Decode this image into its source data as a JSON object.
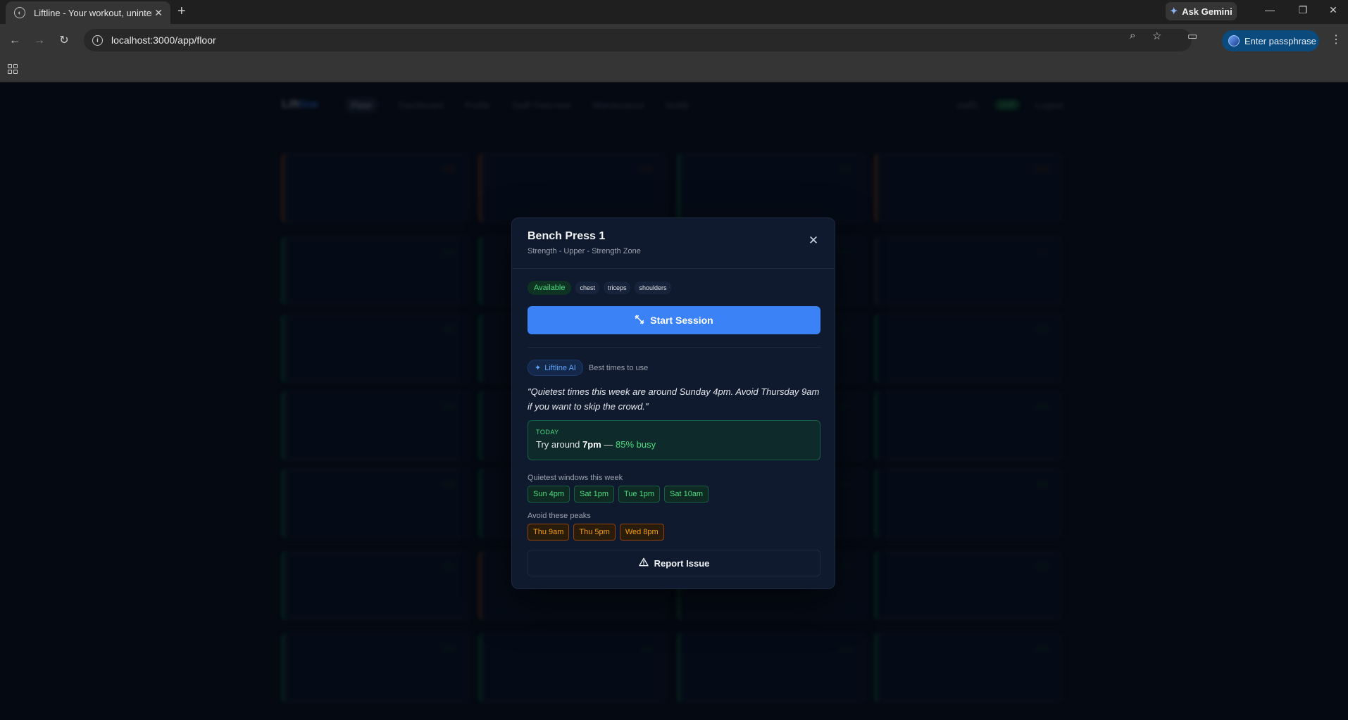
{
  "browser": {
    "tab_title": "Liftline - Your workout, uninterrupted",
    "url": "localhost:3000/app/floor",
    "gemini_label": "Ask Gemini",
    "passphrase_label": "Enter passphrase"
  },
  "app_nav": {
    "logo_main": "Lift",
    "logo_accent": "line",
    "items": [
      "Floor",
      "Dashboard",
      "Profile",
      "Staff Overview",
      "Maintenance",
      "Notify"
    ],
    "user": "staff1",
    "role_pill": "staff",
    "logout": "Logout"
  },
  "modal": {
    "title": "Bench Press 1",
    "subtitle": "Strength - Upper - Strength Zone",
    "status": "Available",
    "muscles": [
      "chest",
      "triceps",
      "shoulders"
    ],
    "start_label": "Start Session",
    "ai_badge": "Liftline AI",
    "ai_label": "Best times to use",
    "quote": "\"Quietest times this week are around Sunday 4pm. Avoid Thursday 9am if you want to skip the crowd.\"",
    "today_label": "TODAY",
    "today_prefix": "Try around",
    "today_time": "7pm",
    "today_sep": "—",
    "today_busy": "85% busy",
    "quiet_label": "Quietest windows this week",
    "quiet_windows": [
      "Sun 4pm",
      "Sat 1pm",
      "Tue 1pm",
      "Sat 10am"
    ],
    "peaks_label": "Avoid these peaks",
    "peaks": [
      "Thu 9am",
      "Thu 5pm",
      "Wed 8pm"
    ],
    "report_label": "Report Issue"
  }
}
